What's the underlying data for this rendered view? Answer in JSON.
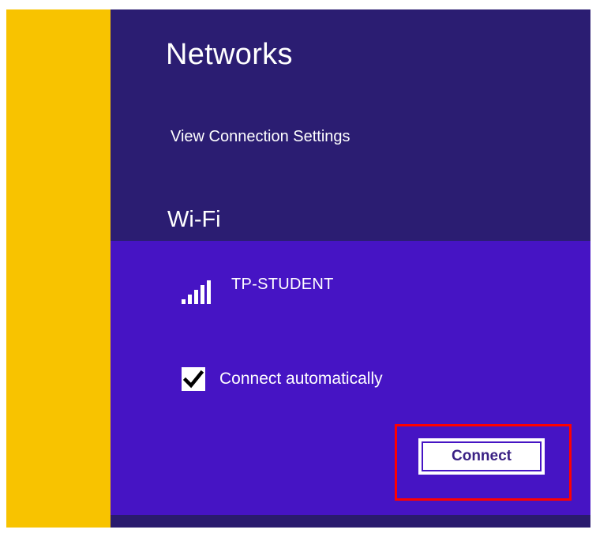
{
  "panel": {
    "title": "Networks",
    "settings_link": "View Connection Settings",
    "section_label": "Wi-Fi"
  },
  "network": {
    "name": "TP-STUDENT",
    "signal_icon": "wifi-signal-bars-icon",
    "signal_bars_filled": 5,
    "signal_bars_total": 5,
    "connect_automatically": {
      "label": "Connect automatically",
      "checked": true,
      "icon": "checkmark-icon"
    },
    "connect_button": "Connect"
  },
  "colors": {
    "accent_strip": "#f8c300",
    "panel_background": "#2b1d72",
    "selected_item_background": "#4614c4",
    "highlight_box": "#ff0000"
  }
}
